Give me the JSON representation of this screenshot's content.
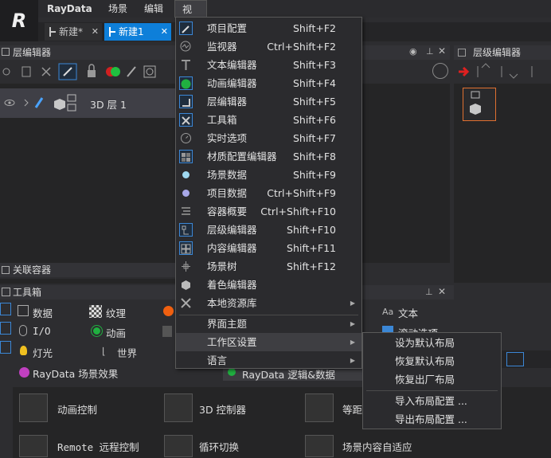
{
  "app": {
    "logo": "R",
    "menubar": [
      {
        "label": "RayData"
      },
      {
        "label": "场景"
      },
      {
        "label": "编辑"
      },
      {
        "label": "视图"
      }
    ]
  },
  "tabs": [
    {
      "label": "新建*",
      "close": "✕"
    },
    {
      "label": "新建1",
      "close": "✕"
    }
  ],
  "layer_panel": {
    "title": "层编辑器",
    "row_label": "3D 层 1"
  },
  "hierarchy_panel": {
    "title": "层级编辑器"
  },
  "associate_panel": {
    "title": "关联容器"
  },
  "toolbox": {
    "title": "工具箱",
    "items": [
      {
        "label": "数据"
      },
      {
        "label": "纹理"
      },
      {
        "label": "I/O"
      },
      {
        "label": "动画"
      },
      {
        "label": "灯光"
      },
      {
        "label": "世界"
      },
      {
        "label": "RayData 场景效果"
      },
      {
        "label": "文本"
      },
      {
        "label": "滚动选项"
      },
      {
        "label": "RayData 逻辑&数据"
      }
    ],
    "big_buttons": [
      {
        "label": "动画控制"
      },
      {
        "label": "3D 控制器"
      },
      {
        "label": "等距"
      },
      {
        "label": "Remote 远程控制"
      },
      {
        "label": "循环切换"
      },
      {
        "label": "场景内容自适应"
      }
    ]
  },
  "view_menu": {
    "items": [
      {
        "label": "项目配置",
        "shortcut": "Shift+F2",
        "icon": "pencil-icon"
      },
      {
        "label": "监视器",
        "shortcut": "Ctrl+Shift+F2",
        "icon": "monitor-icon"
      },
      {
        "label": "文本编辑器",
        "shortcut": "Shift+F3",
        "icon": "text-icon"
      },
      {
        "label": "动画编辑器",
        "shortcut": "Shift+F4",
        "icon": "animation-icon"
      },
      {
        "label": "层编辑器",
        "shortcut": "Shift+F5",
        "icon": "layer-icon"
      },
      {
        "label": "工具箱",
        "shortcut": "Shift+F6",
        "icon": "toolbox-icon"
      },
      {
        "label": "实时选项",
        "shortcut": "Shift+F7",
        "icon": "clock-icon"
      },
      {
        "label": "材质配置编辑器",
        "shortcut": "Shift+F8",
        "icon": "material-icon"
      },
      {
        "label": "场景数据",
        "shortcut": "Shift+F9",
        "icon": "dot-cyan-icon"
      },
      {
        "label": "项目数据",
        "shortcut": "Ctrl+Shift+F9",
        "icon": "dot-purple-icon"
      },
      {
        "label": "容器概要",
        "shortcut": "Ctrl+Shift+F10",
        "icon": "list-icon"
      },
      {
        "label": "层级编辑器",
        "shortcut": "Shift+F10",
        "icon": "hierarchy-icon"
      },
      {
        "label": "内容编辑器",
        "shortcut": "Shift+F11",
        "icon": "content-icon"
      },
      {
        "label": "场景树",
        "shortcut": "Shift+F12",
        "icon": "tree-icon"
      },
      {
        "label": "着色编辑器",
        "shortcut": "",
        "icon": "cube-icon"
      },
      {
        "label": "本地资源库",
        "shortcut": "",
        "icon": "tools-icon",
        "arrow": "▶"
      }
    ],
    "lower": [
      {
        "label": "界面主题",
        "arrow": "▶"
      },
      {
        "label": "工作区设置",
        "arrow": "▶"
      },
      {
        "label": "语言",
        "arrow": "▶"
      }
    ]
  },
  "workspace_submenu": {
    "items": [
      {
        "label": "设为默认布局"
      },
      {
        "label": "恢复默认布局"
      },
      {
        "label": "恢复出厂布局"
      },
      {
        "label": "导入布局配置 ..."
      },
      {
        "label": "导出布局配置 ..."
      }
    ]
  },
  "colors": {
    "accent": "#0e7fd9",
    "bg": "#2d2d30",
    "menu_bg": "#2b2b2e"
  }
}
